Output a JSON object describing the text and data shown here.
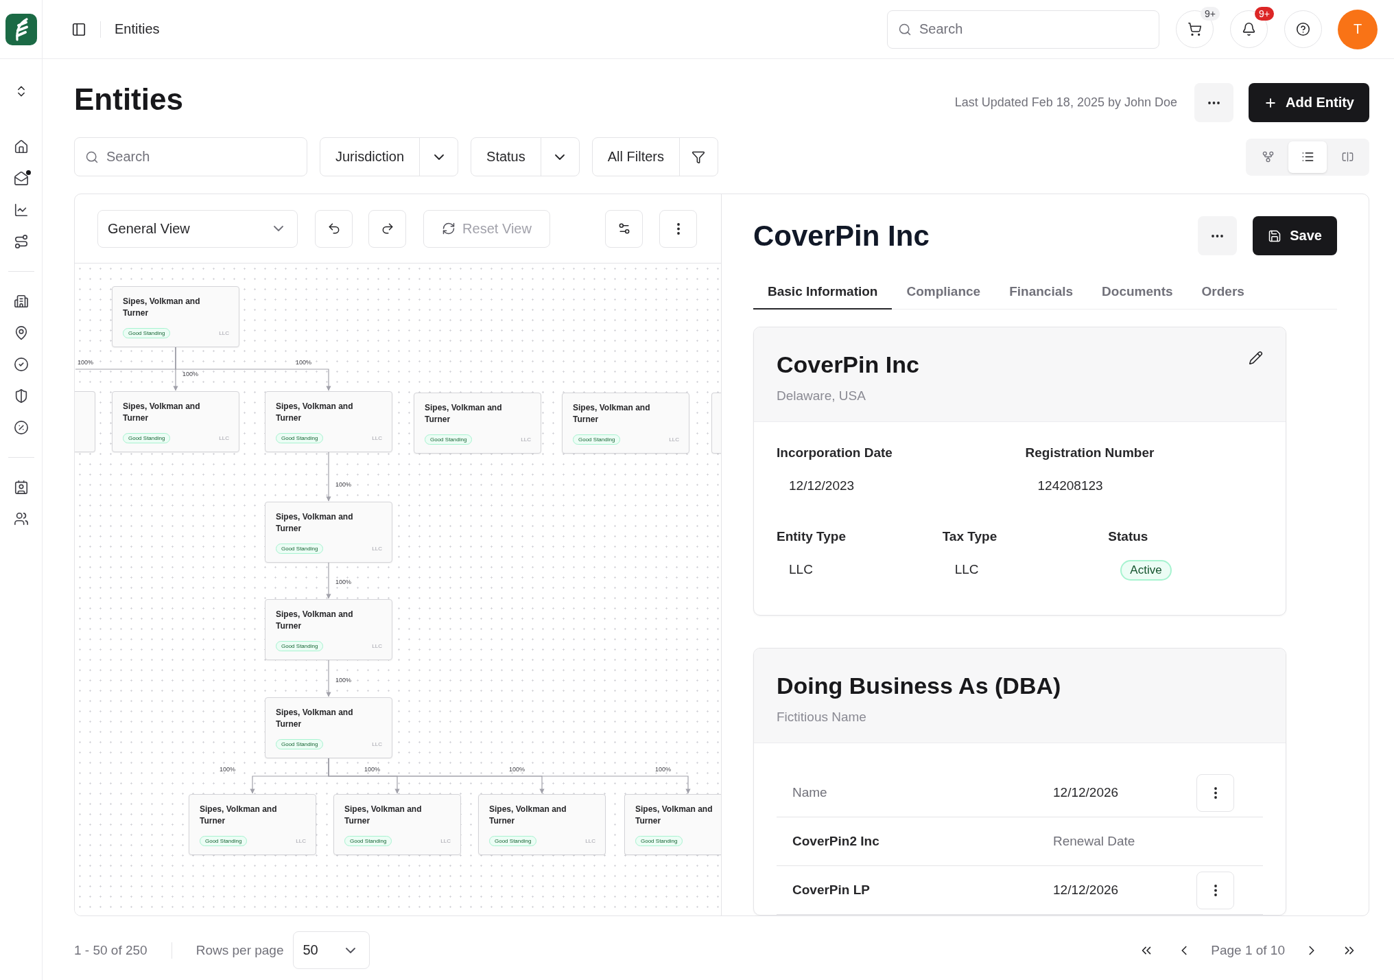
{
  "sidebar": {
    "groups": [
      {
        "items": [
          {
            "dot": false
          },
          {
            "dot": true
          },
          {
            "dot": false
          },
          {
            "dot": false
          }
        ]
      },
      {
        "items": [
          {
            "dot": false
          },
          {
            "dot": false
          },
          {
            "dot": false
          },
          {
            "dot": false
          },
          {
            "dot": false
          }
        ]
      },
      {
        "items": [
          {
            "dot": false
          },
          {
            "dot": false
          }
        ]
      }
    ]
  },
  "header": {
    "breadcrumb": "Entities",
    "search": {
      "placeholder": "Search"
    },
    "cart": {
      "badge": "9+",
      "urgent": false
    },
    "notifications": {
      "badge": "9+",
      "urgent": true
    },
    "avatar": {
      "initial": "T"
    }
  },
  "page": {
    "title": "Entities",
    "last_updated": "Last Updated Feb 18, 2025 by John Doe",
    "add_button": "Add Entity"
  },
  "filters": {
    "search": {
      "placeholder": "Search"
    },
    "dropdowns": [
      {
        "label": "Jurisdiction"
      },
      {
        "label": "Status"
      }
    ],
    "all_filters": "All Filters"
  },
  "view_modes": [
    {
      "selected": false
    },
    {
      "selected": true
    },
    {
      "selected": false
    }
  ],
  "chart_panel": {
    "toolbar": {
      "view": "General View",
      "reset": {
        "label": "Reset View",
        "disabled": true
      }
    },
    "org_chart": {
      "roots": [
        {
          "kind": "card",
          "name": "Sipes, Volkman and Turner",
          "status": "Good Standing",
          "type": "LLC",
          "children": [
            {
              "kind": "partial",
              "ownership": "100%"
            },
            {
              "kind": "card",
              "name": "Sipes, Volkman and Turner",
              "status": "Good Standing",
              "type": "LLC",
              "ownership": "100%"
            },
            {
              "kind": "card",
              "name": "Sipes, Volkman and Turner",
              "status": "Good Standing",
              "type": "LLC",
              "ownership": "100%",
              "children": [
                {
                  "kind": "card",
                  "name": "Sipes, Volkman and Turner",
                  "status": "Good Standing",
                  "type": "LLC",
                  "ownership": "100%",
                  "children": [
                    {
                      "kind": "card",
                      "name": "Sipes, Volkman and Turner",
                      "status": "Good Standing",
                      "type": "LLC",
                      "ownership": "100%",
                      "children": [
                        {
                          "kind": "card",
                          "name": "Sipes, Volkman and Turner",
                          "status": "Good Standing",
                          "type": "LLC",
                          "ownership": "100%",
                          "children": [
                            {
                              "kind": "card",
                              "name": "Sipes, Volkman and Turner",
                              "status": "Good Standing",
                              "type": "LLC",
                              "ownership": "100%"
                            },
                            {
                              "kind": "card",
                              "name": "Sipes, Volkman and Turner",
                              "status": "Good Standing",
                              "type": "LLC",
                              "ownership": "100%"
                            },
                            {
                              "kind": "card",
                              "name": "Sipes, Volkman and Turner",
                              "status": "Good Standing",
                              "type": "LLC",
                              "ownership": "100%"
                            },
                            {
                              "kind": "card",
                              "name": "Sipes, Volkman and Turner",
                              "status": "Good Standing",
                              "ownership": "100%"
                            }
                          ]
                        }
                      ]
                    }
                  ]
                }
              ]
            }
          ]
        },
        {
          "kind": "card",
          "name": "Sipes, Volkman and Turner",
          "status": "Good Standing",
          "type": "LLC"
        },
        {
          "kind": "card",
          "name": "Sipes, Volkman and Turner",
          "status": "Good Standing",
          "type": "LLC"
        },
        {
          "kind": "partial"
        }
      ]
    }
  },
  "detail": {
    "title": "CoverPin Inc",
    "save_button": "Save",
    "tabs": [
      {
        "label": "Basic Information",
        "selected": true
      },
      {
        "label": "Compliance",
        "selected": false
      },
      {
        "label": "Financials",
        "selected": false
      },
      {
        "label": "Documents",
        "selected": false
      },
      {
        "label": "Orders",
        "selected": false
      }
    ],
    "profile": {
      "name": "CoverPin Inc",
      "location": "Delaware, USA",
      "rows": [
        {
          "fields": [
            {
              "label": "Incorporation Date",
              "value": "12/12/2023",
              "kind": "text"
            },
            {
              "label": "Registration Number",
              "value": "124208123",
              "kind": "text"
            }
          ]
        },
        {
          "fields": [
            {
              "label": "Entity Type",
              "value": "LLC",
              "kind": "text"
            },
            {
              "label": "Tax Type",
              "value": "LLC",
              "kind": "text"
            },
            {
              "label": "Status",
              "value": "Active",
              "kind": "badge"
            }
          ]
        }
      ]
    },
    "dba": {
      "title": "Doing Business As (DBA)",
      "subtitle": "Fictitious Name",
      "rows": [
        {
          "cells": [
            {
              "text": "Name",
              "muted": true
            },
            {
              "text": "12/12/2026",
              "muted": false
            }
          ],
          "menu": true
        },
        {
          "cells": [
            {
              "text": "CoverPin2 Inc",
              "muted": false
            },
            {
              "text": "Renewal Date",
              "muted": true
            }
          ],
          "menu": false
        },
        {
          "cells": [
            {
              "text": "CoverPin LP",
              "muted": false
            },
            {
              "text": "12/12/2026",
              "muted": false
            }
          ],
          "menu": true
        }
      ]
    }
  },
  "pagination": {
    "range": "1 - 50 of 250",
    "rows_label": "Rows per page",
    "rows_per_page": "50",
    "page": "Page 1 of 10"
  }
}
